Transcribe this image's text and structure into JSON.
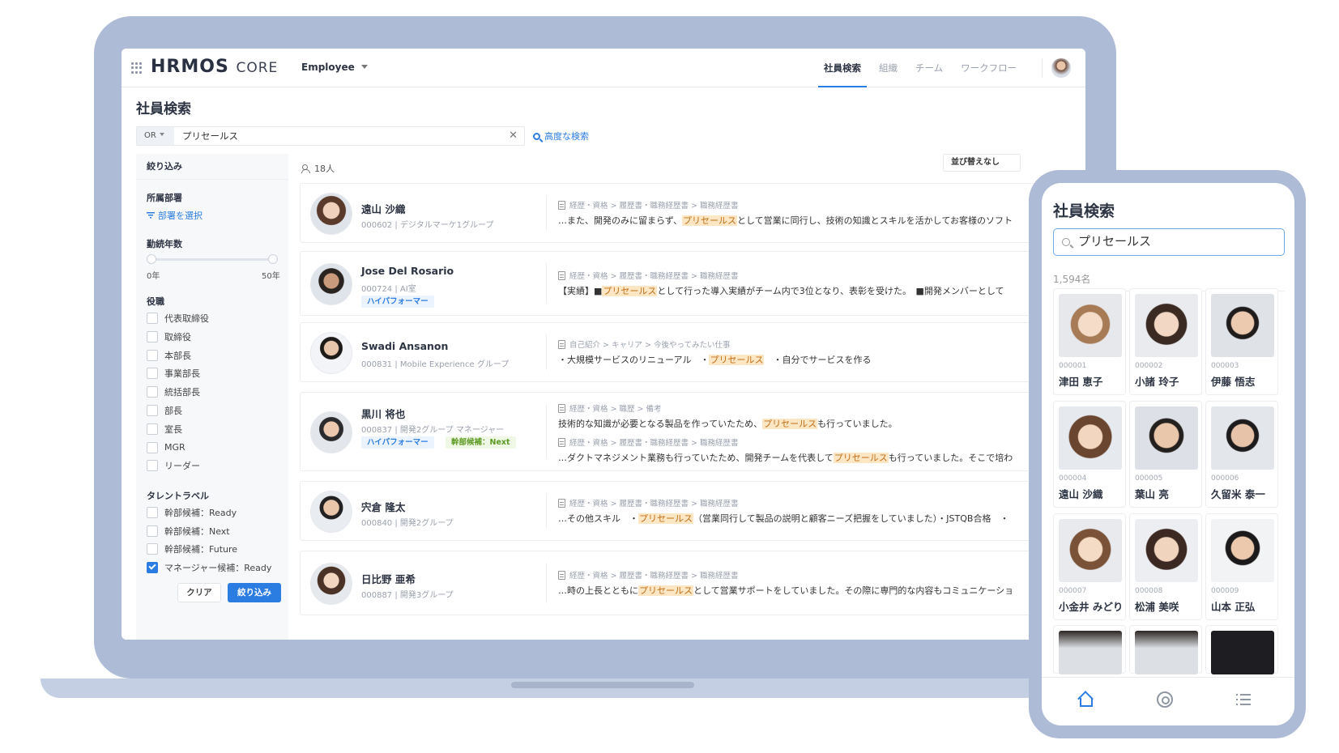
{
  "header": {
    "logo_main": "HRMOS",
    "logo_sub": "CORE",
    "employee_select": "Employee",
    "nav": [
      "社員検索",
      "組織",
      "チーム",
      "ワークフロー"
    ]
  },
  "page_title": "社員検索",
  "search": {
    "operator": "OR",
    "value": "プリセールス",
    "advanced_label": "高度な検索"
  },
  "filter": {
    "heading": "絞り込み",
    "department_label": "所属部署",
    "department_link": "部署を選択",
    "tenure_label": "勤続年数",
    "tenure_min": "0年",
    "tenure_max": "50年",
    "role_label": "役職",
    "roles": [
      "代表取締役",
      "取締役",
      "本部長",
      "事業部長",
      "統括部長",
      "部長",
      "室長",
      "MGR",
      "リーダー"
    ],
    "talent_label": "タレントラベル",
    "talents": [
      "幹部候補：Ready",
      "幹部候補：Next",
      "幹部候補：Future",
      "マネージャー候補：Ready"
    ],
    "talent_checked": [
      false,
      false,
      false,
      true
    ],
    "clear_label": "クリア",
    "apply_label": "絞り込み"
  },
  "results": {
    "count": "18人",
    "sort_label": "並び替えなし",
    "cards": [
      {
        "name": "遠山 沙織",
        "meta": "000602 | デジタルマーケ1グループ",
        "badges": [],
        "snippets": [
          {
            "crumb": "経歴・資格 > 履歴書・職務経歴書 > 職務経歴書",
            "pre": "…また、開発のみに留まらず、",
            "hl": "プリセールス",
            "post": "として営業に同行し、技術の知識とスキルを活かしてお客様のソフト"
          }
        ]
      },
      {
        "name": "Jose Del Rosario",
        "meta": "000724 | AI室",
        "badges": [
          "ハイパフォーマー"
        ],
        "snippets": [
          {
            "crumb": "経歴・資格 > 履歴書・職務経歴書 > 職務経歴書",
            "pre": "【実績】■",
            "hl": "プリセールス",
            "post": "として行った導入実績がチーム内で3位となり、表彰を受けた。　■開発メンバーとして"
          }
        ]
      },
      {
        "name": "Swadi Ansanon",
        "meta": "000831 | Mobile Experience グループ",
        "badges": [],
        "snippets": [
          {
            "crumb": "自己紹介 > キャリア > 今後やってみたい仕事",
            "pre": "・大規模サービスのリニューアル　・",
            "hl": "プリセールス",
            "post": "　・自分でサービスを作る"
          }
        ]
      },
      {
        "name": "黒川 将也",
        "meta": "000837 | 開発2グループ マネージャー",
        "badges": [
          "ハイパフォーマー",
          "幹部候補：Next"
        ],
        "snippets": [
          {
            "crumb": "経歴・資格 > 職歴 > 備考",
            "pre": "技術的な知識が必要となる製品を作っていたため、",
            "hl": "プリセールス",
            "post": "も行っていました。"
          },
          {
            "crumb": "経歴・資格 > 履歴書・職務経歴書 > 職務経歴書",
            "pre": "…ダクトマネジメント業務も行っていたため、開発チームを代表して",
            "hl": "プリセールス",
            "post": "も行っていました。そこで培わ"
          }
        ]
      },
      {
        "name": "宍倉 隆太",
        "meta": "000840 | 開発2グループ",
        "badges": [],
        "snippets": [
          {
            "crumb": "経歴・資格 > 履歴書・職務経歴書 > 職務経歴書",
            "pre": "…その他スキル　・",
            "hl": "プリセールス",
            "post": "（営業同行して製品の説明と顧客ニーズ把握をしていました）・JSTQB合格　・"
          }
        ]
      },
      {
        "name": "日比野 亜希",
        "meta": "000887 | 開発3グループ",
        "badges": [],
        "snippets": [
          {
            "crumb": "経歴・資格 > 履歴書・職務経歴書 > 職務経歴書",
            "pre": "…時の上長とともに",
            "hl": "プリセールス",
            "post": "として営業サポートをしていました。その際に専門的な内容もコミュニケーショ"
          }
        ]
      }
    ]
  },
  "phone": {
    "title": "社員検索",
    "search_value": "プリセールス",
    "count": "1,594名",
    "employees": [
      {
        "id": "000001",
        "name": "津田 恵子"
      },
      {
        "id": "000002",
        "name": "小諸 玲子"
      },
      {
        "id": "000003",
        "name": "伊藤 悟志"
      },
      {
        "id": "000004",
        "name": "遠山 沙織"
      },
      {
        "id": "000005",
        "name": "葉山 亮"
      },
      {
        "id": "000006",
        "name": "久留米 泰一"
      },
      {
        "id": "000007",
        "name": "小金井 みどり"
      },
      {
        "id": "000008",
        "name": "松浦 美咲"
      },
      {
        "id": "000009",
        "name": "山本 正弘"
      }
    ]
  },
  "colors": {
    "accent": "#2b7de1",
    "device": "#aebbd6",
    "highlight_bg": "#fde6c4",
    "highlight_text": "#c0701a"
  }
}
